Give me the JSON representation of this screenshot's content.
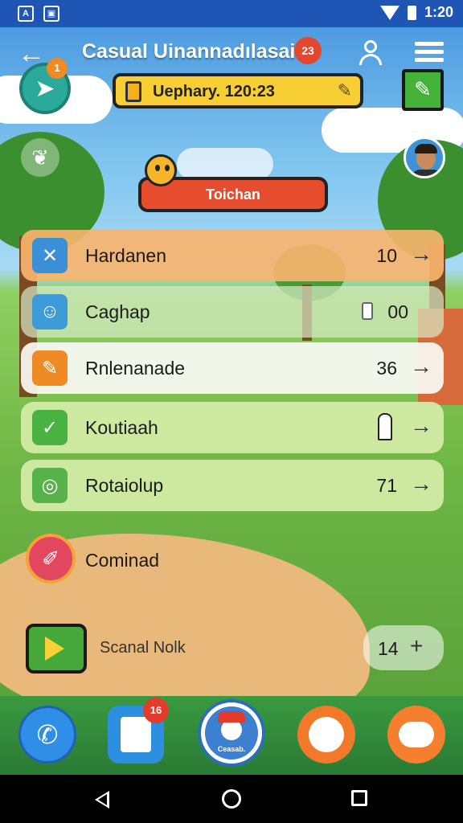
{
  "status_bar": {
    "time": "1:20",
    "left_icons": [
      "A",
      "▣"
    ]
  },
  "header": {
    "title": "Casual Uinannadılasai",
    "title_badge": "23",
    "back_glyph": "←"
  },
  "score": {
    "label": "Uephary. 120:23"
  },
  "send_badge": "1",
  "cta": {
    "label": "Toichan"
  },
  "rows": [
    {
      "label": "Hardanen",
      "value": "10",
      "arrow": "→",
      "bg": "rgba(247,180,110,0.92)",
      "icon_bg": "#3a8fd6",
      "icon": "✕"
    },
    {
      "label": "Caghap",
      "value": "00",
      "arrow": "",
      "bg": "rgba(215,235,200,0.70)",
      "icon_bg": "#3d9cd8",
      "icon": "☺"
    },
    {
      "label": "Rnlenanade",
      "value": "36",
      "arrow": "→",
      "bg": "rgba(250,250,245,0.92)",
      "icon_bg": "#f08a25",
      "icon": "✎"
    },
    {
      "label": "Koutiaah",
      "value": "",
      "arrow": "→",
      "bg": "rgba(215,238,170,0.90)",
      "icon_bg": "#49b342",
      "icon": "✓"
    },
    {
      "label": "Rotaiolup",
      "value": "71",
      "arrow": "→",
      "bg": "rgba(215,238,170,0.90)",
      "icon_bg": "#58b24a",
      "icon": "◎"
    }
  ],
  "combined": {
    "label": "Cominad"
  },
  "scan": {
    "label": "Scanal Nolk",
    "value": "14",
    "arrow": "+"
  },
  "dock": {
    "notes_badge": "16",
    "game_label": "Ceasab."
  },
  "colors": {
    "status_bar": "#1f56b6",
    "accent": "#e54d2e",
    "score_pill": "#f7cf34"
  }
}
